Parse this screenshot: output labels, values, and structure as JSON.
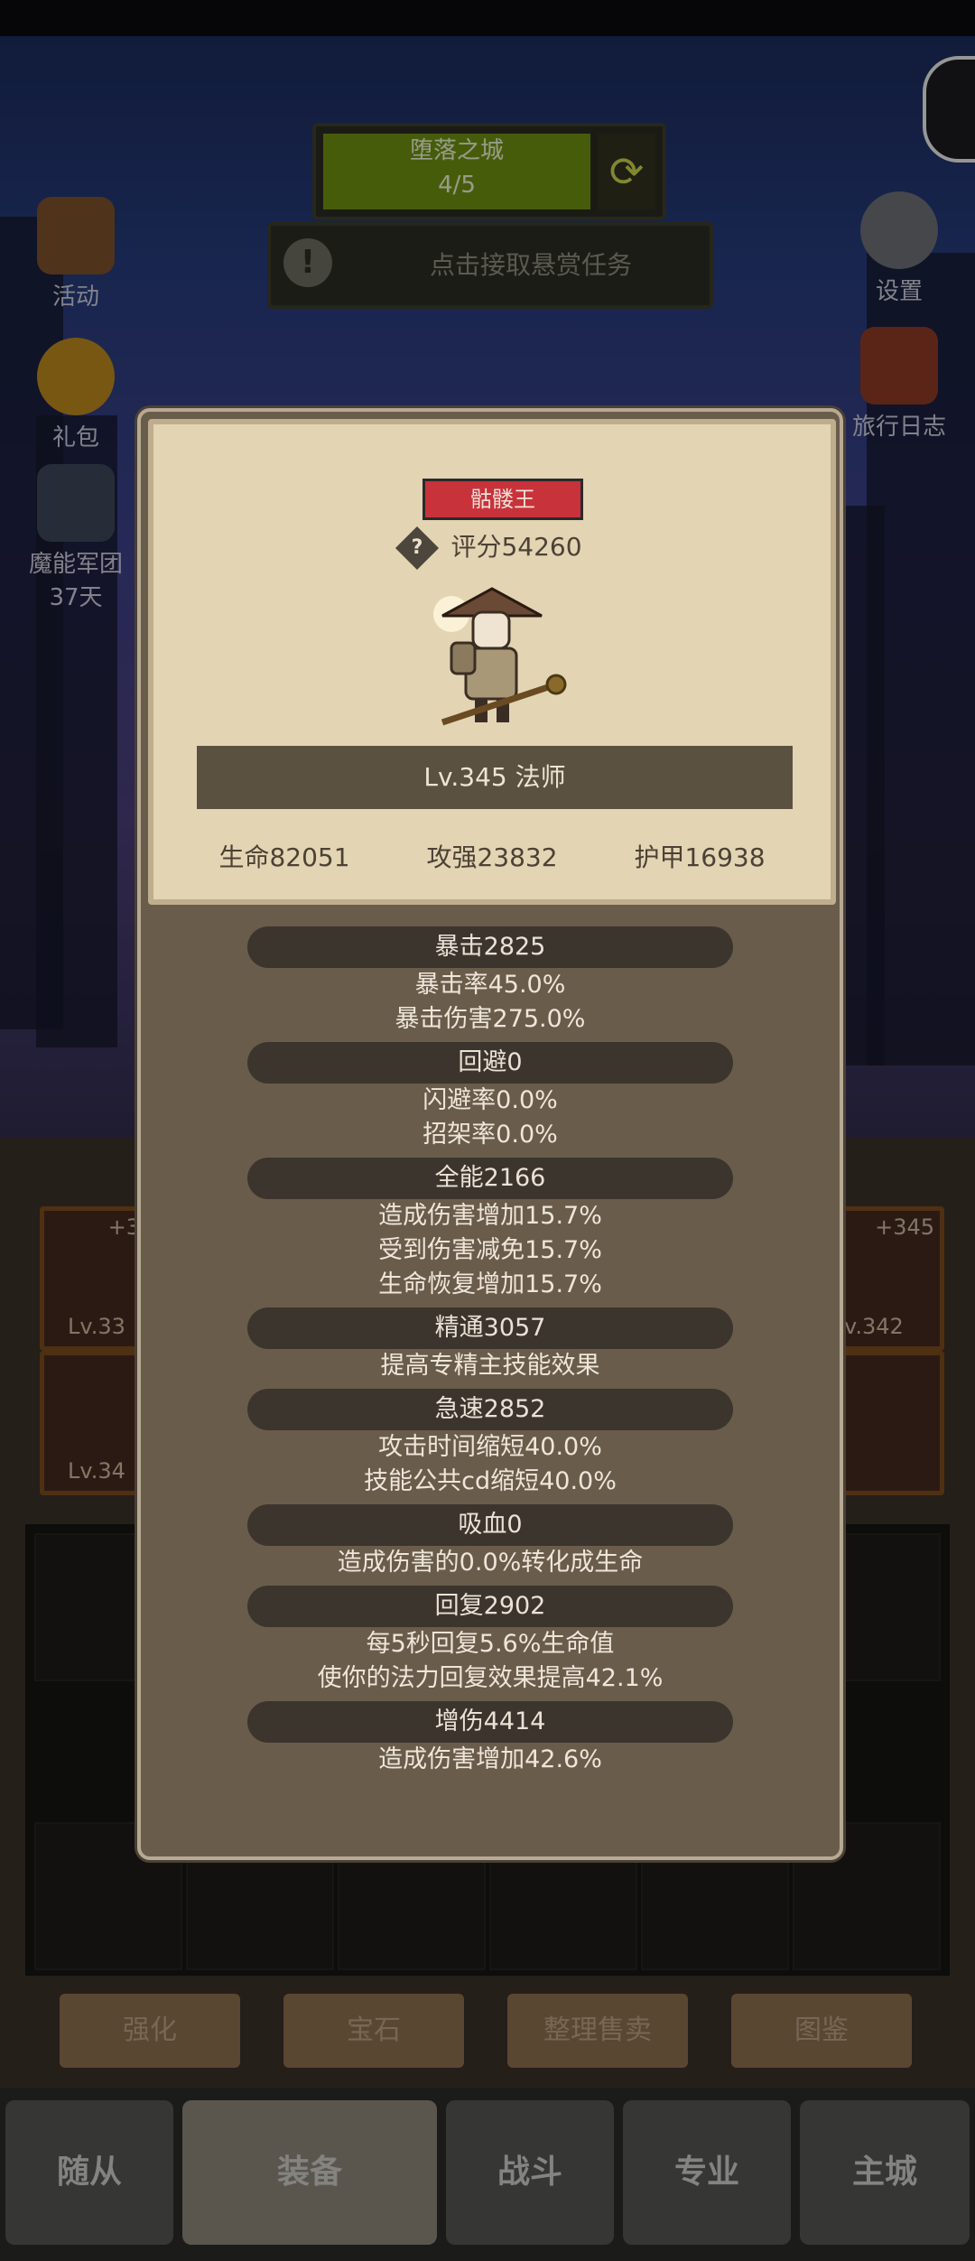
{
  "map": {
    "name": "堕落之城",
    "progress": "4/5"
  },
  "bounty": {
    "label": "点击接取悬赏任务"
  },
  "left_menu": [
    {
      "label": "活动",
      "icon": "scroll-icon"
    },
    {
      "label": "礼包",
      "icon": "giftbag-icon"
    },
    {
      "label": "魔能军团",
      "sub": "37天",
      "icon": "legion-icon"
    }
  ],
  "right_menu": [
    {
      "label": "设置",
      "icon": "gear-icon"
    },
    {
      "label": "旅行日志",
      "icon": "book-icon"
    }
  ],
  "equipment_slots": [
    {
      "plus": "+3",
      "level": "Lv.33"
    },
    {
      "plus": "+345",
      "level": "v.342"
    },
    {
      "plus": "",
      "level": "Lv.34"
    },
    {
      "plus": "",
      "level": ""
    }
  ],
  "actions": [
    "强化",
    "宝石",
    "整理售卖",
    "图鉴"
  ],
  "nav": [
    "随从",
    "装备",
    "战斗",
    "专业",
    "主城"
  ],
  "popup": {
    "boss_tag": "骷髅王",
    "score": "评分54260",
    "level_class": "Lv.345 法师",
    "hp": "生命82051",
    "attack": "攻强23832",
    "armor": "护甲16938",
    "attributes": [
      {
        "title": "暴击2825",
        "lines": [
          "暴击率45.0%",
          "暴击伤害275.0%"
        ]
      },
      {
        "title": "回避0",
        "lines": [
          "闪避率0.0%",
          "招架率0.0%"
        ]
      },
      {
        "title": "全能2166",
        "lines": [
          "造成伤害增加15.7%",
          "受到伤害减免15.7%",
          "生命恢复增加15.7%"
        ]
      },
      {
        "title": "精通3057",
        "lines": [
          "提高专精主技能效果"
        ]
      },
      {
        "title": "急速2852",
        "lines": [
          "攻击时间缩短40.0%",
          "技能公共cd缩短40.0%"
        ]
      },
      {
        "title": "吸血0",
        "lines": [
          "造成伤害的0.0%转化成生命"
        ]
      },
      {
        "title": "回复2902",
        "lines": [
          "每5秒回复5.6%生命值",
          "使你的法力回复效果提高42.1%"
        ]
      },
      {
        "title": "增伤4414",
        "lines": [
          "造成伤害增加42.6%"
        ]
      }
    ]
  }
}
